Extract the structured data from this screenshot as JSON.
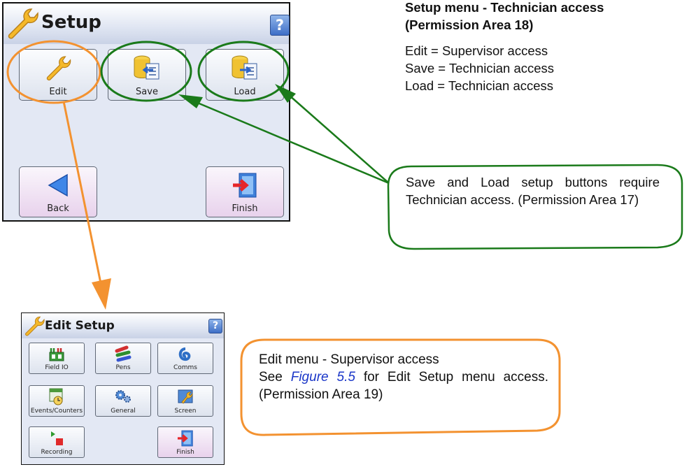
{
  "setup_panel": {
    "title": "Setup",
    "help_label": "?",
    "buttons": {
      "edit": "Edit",
      "save": "Save",
      "load": "Load",
      "back": "Back",
      "finish": "Finish"
    }
  },
  "edit_panel": {
    "title": "Edit Setup",
    "help_label": "?",
    "buttons": {
      "field_io": "Field IO",
      "pens": "Pens",
      "comms": "Comms",
      "events": "Events/Counters",
      "general": "General",
      "screen": "Screen",
      "recording": "Recording",
      "finish": "Finish"
    }
  },
  "setup_note": {
    "heading_line1": "Setup menu - Technician access",
    "heading_line2": "(Permission Area 18)",
    "line1": "Edit = Supervisor access",
    "line2": "Save = Technician access",
    "line3": "Load = Technician access"
  },
  "save_load_callout": {
    "text": "Save and Load setup buttons require Technician access. (Permission Area 17)"
  },
  "edit_callout": {
    "line1": "Edit menu - Supervisor access",
    "pre": "See ",
    "link": "Figure 5.5",
    "post": " for Edit Setup menu access. (Permission Area 19)"
  },
  "colors": {
    "green": "#1a7a1a",
    "orange": "#f39230",
    "link": "#1a36c8"
  }
}
